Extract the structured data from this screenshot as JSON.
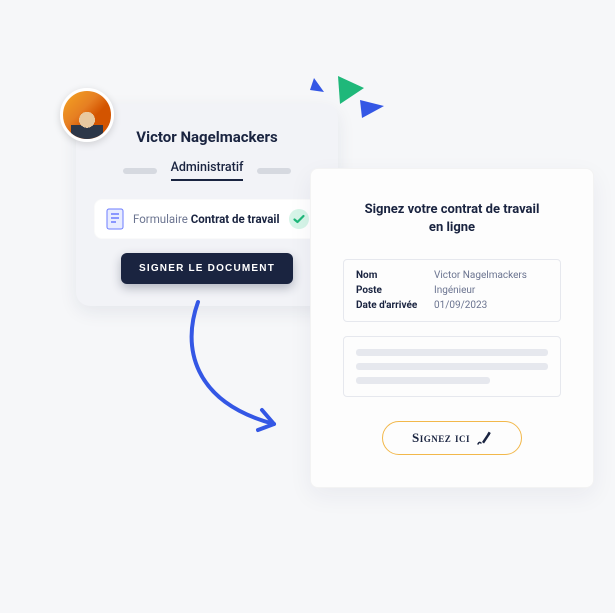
{
  "profile": {
    "name": "Victor Nagelmackers",
    "active_tab": "Administratif",
    "form_row": {
      "light_label": "Formulaire ",
      "bold_label": "Contrat de travail"
    },
    "sign_button": "SIGNER LE DOCUMENT"
  },
  "document": {
    "title_line1": "Signez votre contrat de travail",
    "title_line2": "en ligne",
    "fields": [
      {
        "label": "Nom",
        "value": "Victor Nagelmackers"
      },
      {
        "label": "Poste",
        "value": "Ingénieur"
      },
      {
        "label": "Date d'arrivée",
        "value": "01/09/2023"
      }
    ],
    "sign_here": "Signez ici"
  },
  "colors": {
    "accent_blue": "#3457e5",
    "accent_green": "#1fb87a",
    "dark_navy": "#1a2440",
    "sign_border": "#f2b84b"
  }
}
